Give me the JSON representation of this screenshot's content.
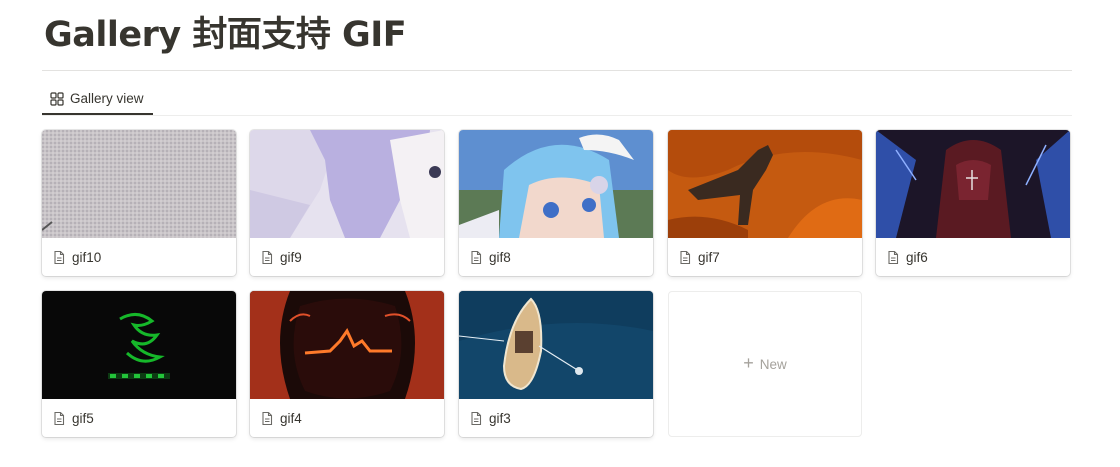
{
  "page": {
    "title": "Gallery 封面支持  GIF"
  },
  "tabs": [
    {
      "label": "Gallery view",
      "icon": "gallery-grid-icon"
    }
  ],
  "cards": [
    {
      "name": "gif10",
      "icon": "page-icon"
    },
    {
      "name": "gif9",
      "icon": "page-icon"
    },
    {
      "name": "gif8",
      "icon": "page-icon"
    },
    {
      "name": "gif7",
      "icon": "page-icon"
    },
    {
      "name": "gif6",
      "icon": "page-icon"
    },
    {
      "name": "gif5",
      "icon": "page-icon"
    },
    {
      "name": "gif4",
      "icon": "page-icon"
    },
    {
      "name": "gif3",
      "icon": "page-icon"
    }
  ],
  "new_card": {
    "label": "New",
    "icon": "plus-icon"
  },
  "colors": {
    "text": "#37352f",
    "muted": "#a5a29c",
    "divider": "#e3e2e0"
  }
}
